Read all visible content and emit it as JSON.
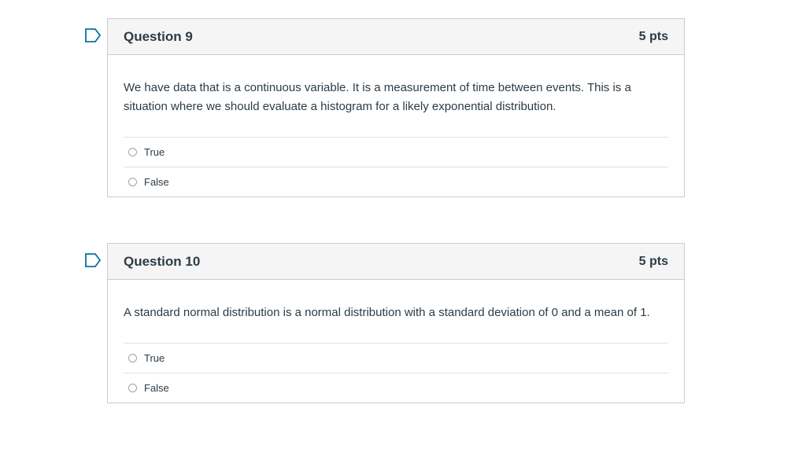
{
  "questions": [
    {
      "name": "Question 9",
      "points": "5 pts",
      "text": "We have data that is a continuous variable. It is a measurement of time between events. This is a situation where we should evaluate a histogram for a likely exponential distribution.",
      "answers": [
        "True",
        "False"
      ]
    },
    {
      "name": "Question 10",
      "points": "5 pts",
      "text": "A standard normal distribution is a normal distribution with a standard deviation of 0 and a mean of 1.",
      "answers": [
        "True",
        "False"
      ]
    }
  ],
  "colors": {
    "flag": "#0770a3",
    "text": "#2d3b45",
    "header_bg": "#f5f5f5",
    "border": "#c7cdd1"
  },
  "icons": {
    "flag": "flag-outline-icon",
    "radio": "radio-empty-icon"
  }
}
